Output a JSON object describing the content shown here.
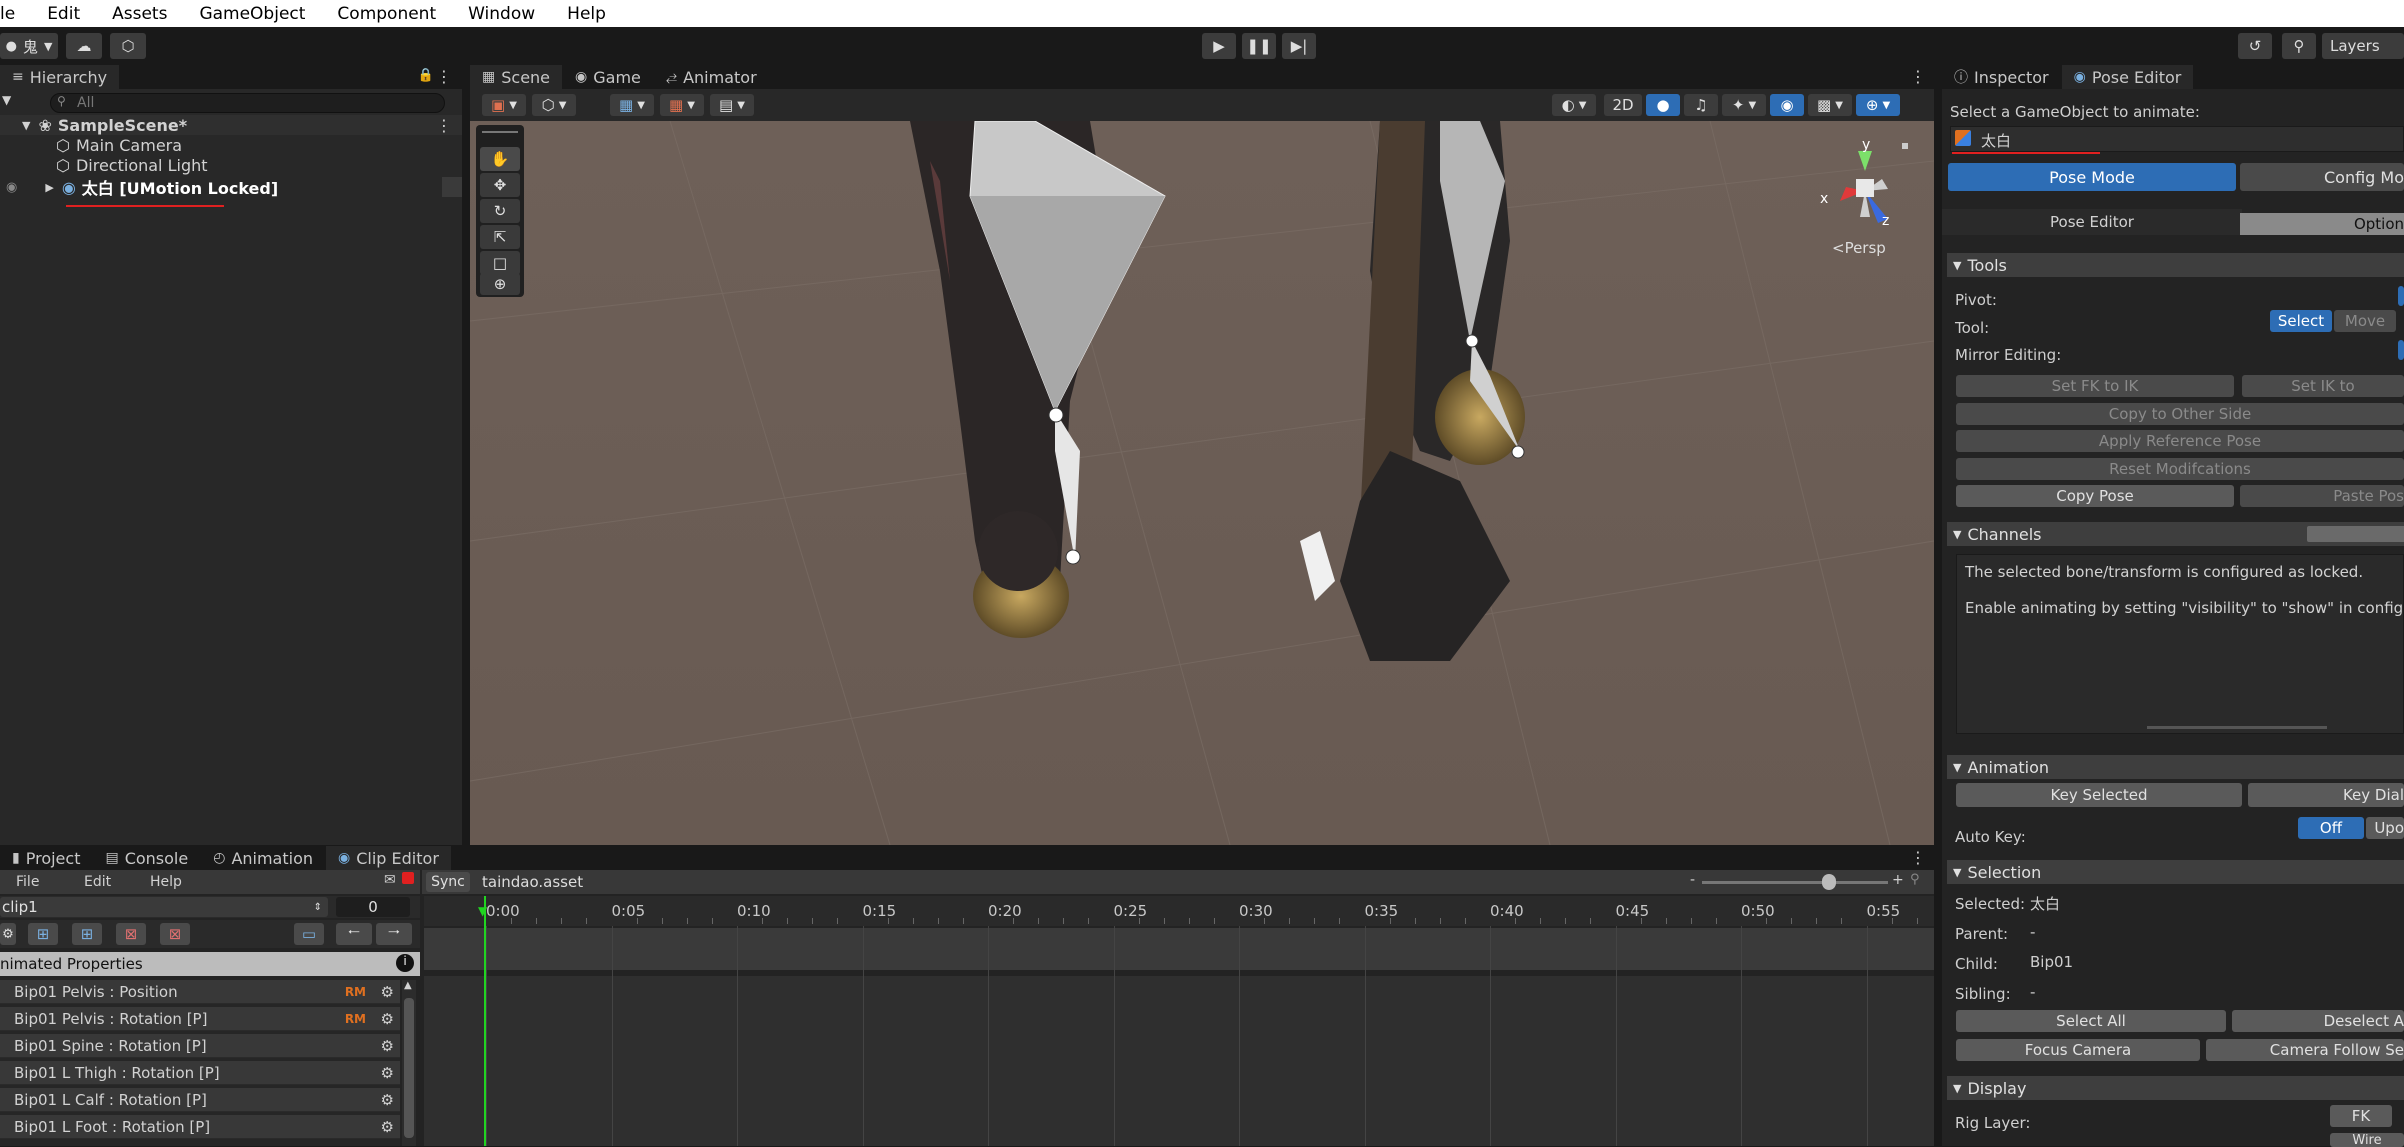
{
  "menu": [
    "le",
    "Edit",
    "Assets",
    "GameObject",
    "Component",
    "Window",
    "Help"
  ],
  "toolbar": {
    "account_label": "鬼",
    "layers_label": "Layers",
    "play_icon": "play-icon",
    "pause_icon": "pause-icon",
    "step_icon": "step-icon"
  },
  "hierarchy": {
    "tab_label": "Hierarchy",
    "search_placeholder": "All",
    "scene_name": "SampleScene*",
    "items": [
      "Main Camera",
      "Directional Light",
      "太白 [UMotion Locked]"
    ]
  },
  "scene_tabs": [
    "Scene",
    "Game",
    "Animator"
  ],
  "scene": {
    "btn_2d": "2D",
    "persp_label": "<Persp",
    "gizmo_axes": [
      "y",
      "x",
      "z"
    ]
  },
  "bottom_tabs": [
    "Project",
    "Console",
    "Animation",
    "Clip Editor"
  ],
  "clip_editor": {
    "menu": [
      "File",
      "Edit",
      "Help"
    ],
    "sync_label": "Sync",
    "asset_name": "taindao.asset",
    "clip_name": "clip1",
    "frame_value": "0",
    "animated_properties_label": "nimated Properties",
    "rm_badge": "RM",
    "properties": [
      "Bip01 Pelvis : Position",
      "Bip01 Pelvis : Rotation [P]",
      "Bip01 Spine : Rotation [P]",
      "Bip01 L Thigh : Rotation [P]",
      "Bip01 L Calf : Rotation [P]",
      "Bip01 L Foot : Rotation [P]"
    ],
    "timeline_ticks": [
      "0:00",
      "0:05",
      "0:10",
      "0:15",
      "0:20",
      "0:25",
      "0:30",
      "0:35",
      "0:40",
      "0:45",
      "0:50",
      "0:55"
    ],
    "zoom_minus": "-",
    "zoom_plus": "+"
  },
  "inspector": {
    "tabs": [
      "Inspector",
      "Pose Editor"
    ],
    "select_label": "Select a GameObject to animate:",
    "selected_object": "太白",
    "pose_mode": "Pose Mode",
    "config_mode": "Config Mo",
    "subtabs": [
      "Pose Editor",
      "Option"
    ],
    "tools": {
      "title": "Tools",
      "pivot": "Pivot:",
      "tool": "Tool:",
      "tool_select": "Select",
      "tool_move": "Move",
      "mirror": "Mirror Editing:",
      "set_fk_ik": "Set FK to IK",
      "set_ik_fk": "Set IK to",
      "copy_other": "Copy to Other Side",
      "apply_ref": "Apply Reference Pose",
      "reset_mod": "Reset Modifcations",
      "copy_pose": "Copy Pose",
      "paste_pose": "Paste Pos"
    },
    "channels": {
      "title": "Channels",
      "msg1": "The selected bone/transform is configured as locked.",
      "msg2": "Enable animating by setting \"visibility\" to \"show\" in config mo"
    },
    "animation": {
      "title": "Animation",
      "key_selected": "Key Selected",
      "key_dial": "Key Dial",
      "auto_key": "Auto Key:",
      "off": "Off",
      "up": "Upo"
    },
    "selection": {
      "title": "Selection",
      "selected_label": "Selected:",
      "selected_value": "太白",
      "parent_label": "Parent:",
      "parent_value": "-",
      "child_label": "Child:",
      "child_value": "Bip01",
      "sibling_label": "Sibling:",
      "sibling_value": "-",
      "select_all": "Select All",
      "deselect": "Deselect A",
      "focus_camera": "Focus Camera",
      "camera_follow": "Camera Follow Se"
    },
    "display": {
      "title": "Display",
      "rig_layer": "Rig Layer:",
      "fk": "FK",
      "wire": "Wire"
    }
  },
  "colors": {
    "accent_blue": "#2d6db5",
    "playhead_green": "#21d421",
    "annotation_red": "#e02020"
  }
}
